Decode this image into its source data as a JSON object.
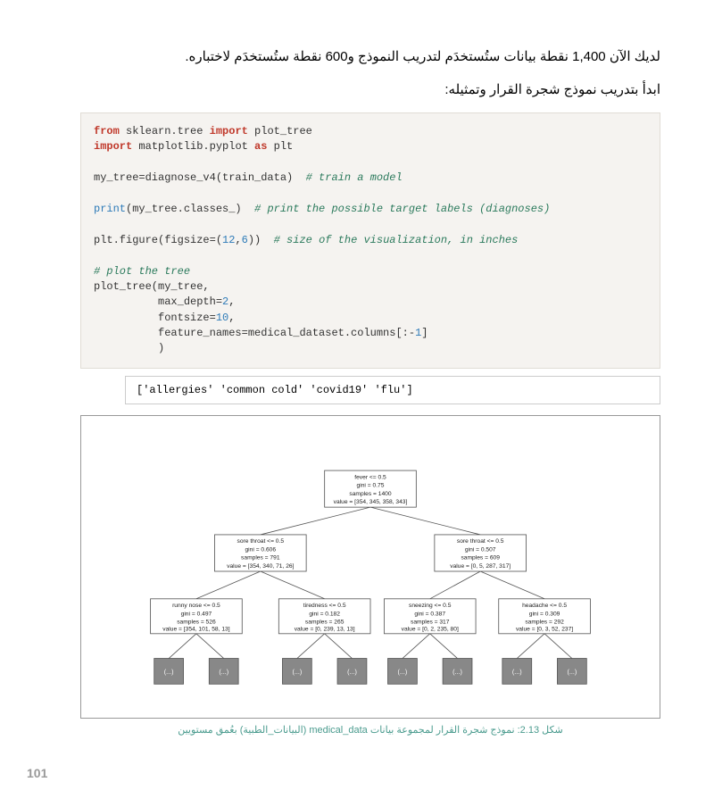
{
  "intro_text_1": "لديك الآن 1,400 نقطة بيانات ستُستخدَم لتدريب النموذج و600 نقطة ستُستخدَم لاختباره.",
  "intro_text_2": "ابدأ بتدريب نموذج شجرة القرار وتمثيله:",
  "code": {
    "t_from": "from",
    "t_import": "import",
    "t_as": "as",
    "t_print": "print",
    "mod1": " sklearn.tree ",
    "name1": " plot_tree",
    "mod2": " matplotlib.pyplot ",
    "name2": " plt",
    "line3a": "my_tree=diagnose_v4(train_data)  ",
    "c3": "# train a model",
    "line4a": "(my_tree.classes_)  ",
    "c4": "# print the possible target labels (diagnoses)",
    "line5a": "plt.figure(figsize=(",
    "n12": "12",
    "comma": ",",
    "n6": "6",
    "line5b": "))  ",
    "c5": "# size of the visualization, in inches",
    "c6": "# plot the tree",
    "line7a": "plot_tree(my_tree,",
    "line7b": "          max_depth=",
    "n2": "2",
    "comma2": ",",
    "line7c": "          fontsize=",
    "n10": "10",
    "comma3": ",",
    "line7d": "          feature_names=medical_dataset.columns[:-",
    "n1": "1",
    "line7e": "]",
    "line7f": "          )"
  },
  "output": "['allergies' 'common cold' 'covid19' 'flu']",
  "tree": {
    "root": {
      "l1": "fever <= 0.5",
      "l2": "gini = 0.75",
      "l3": "samples = 1400",
      "l4": "value = [354, 345, 358, 343]"
    },
    "n1": {
      "l1": "sore throat <= 0.5",
      "l2": "gini = 0.606",
      "l3": "samples = 791",
      "l4": "value = [354, 340, 71, 26]"
    },
    "n2": {
      "l1": "sore throat <= 0.5",
      "l2": "gini = 0.507",
      "l3": "samples = 609",
      "l4": "value = [0, 5, 287, 317]"
    },
    "n11": {
      "l1": "runny nose <= 0.5",
      "l2": "gini = 0.497",
      "l3": "samples = 526",
      "l4": "value = [354, 101, 58, 13]"
    },
    "n12": {
      "l1": "tiredness <= 0.5",
      "l2": "gini = 0.182",
      "l3": "samples = 265",
      "l4": "value = [0, 239, 13, 13]"
    },
    "n21": {
      "l1": "sneezing <= 0.5",
      "l2": "gini = 0.387",
      "l3": "samples = 317",
      "l4": "value = [0, 2, 235, 80]"
    },
    "n22": {
      "l1": "headache <= 0.5",
      "l2": "gini = 0.309",
      "l3": "samples = 292",
      "l4": "value = [0, 3, 52, 237]"
    },
    "leaf_text": "(...)"
  },
  "caption_pre": "شكل 2.13: نموذج شجرة القرار لمجموعة بيانات ",
  "caption_dataset": "medical_data",
  "caption_post": " (البيانات_الطبية) بعُمق مستويين",
  "page_number": "101"
}
